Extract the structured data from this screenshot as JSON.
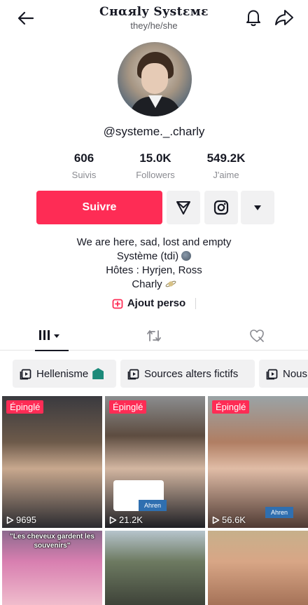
{
  "header": {
    "title": "Cнαяly Systεмε",
    "subtitle": "they/he/she"
  },
  "profile": {
    "handle": "@systeme._.charly"
  },
  "stats": [
    {
      "value": "606",
      "label": "Suivis"
    },
    {
      "value": "15.0K",
      "label": "Followers"
    },
    {
      "value": "549.2K",
      "label": "J'aime"
    }
  ],
  "actions": {
    "follow_label": "Suivre"
  },
  "bio": {
    "line1": "We are here, sad, lost and empty",
    "line2": "Système (tdi)",
    "line3": "Hôtes : Hyrjen, Ross",
    "line4": "Charly"
  },
  "link": {
    "label": "Ajout perso"
  },
  "playlists": [
    {
      "label": "Hellenisme"
    },
    {
      "label": "Sources alters fictifs"
    },
    {
      "label": "Nous"
    }
  ],
  "videos": [
    {
      "pinned": "Épinglé",
      "views": "9695"
    },
    {
      "pinned": "Épinglé",
      "views": "21.2K",
      "tag": "Ahren"
    },
    {
      "pinned": "Épinglé",
      "views": "56.6K",
      "tag": "Ahren"
    },
    {
      "caption": "\"Les cheveux gardent les souvenirs\""
    },
    {},
    {}
  ],
  "colors": {
    "accent": "#fe2c55",
    "text": "#161823",
    "secondary_text": "#8a8b91"
  }
}
